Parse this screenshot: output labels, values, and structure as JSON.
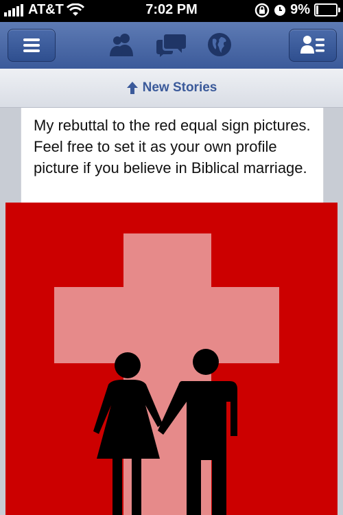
{
  "status_bar": {
    "carrier": "AT&T",
    "time": "7:02 PM",
    "battery": "9%",
    "battery_level": 0.09,
    "icons": [
      "signal-bars-icon",
      "wifi-icon",
      "rotation-lock-icon",
      "alarm-icon",
      "battery-icon"
    ]
  },
  "nav": {
    "buttons": [
      "menu-icon",
      "friend-requests-icon",
      "messages-icon",
      "notifications-globe-icon",
      "contacts-icon"
    ]
  },
  "new_stories": {
    "label": "New Stories",
    "icon": "up-arrow-icon"
  },
  "post": {
    "text": "My rebuttal to the red equal sign pictures.  Feel free to set it as your own profile picture if you believe in Biblical marriage."
  },
  "image": {
    "description_icons": [
      "cross-icon",
      "woman-figure-icon",
      "man-figure-icon"
    ],
    "colors": {
      "background": "#cc0000",
      "cross": "#e68a8a",
      "figures": "#000000"
    }
  },
  "colors": {
    "nav_blue": "#3b5a9a",
    "link_blue": "#3b5a9a"
  }
}
